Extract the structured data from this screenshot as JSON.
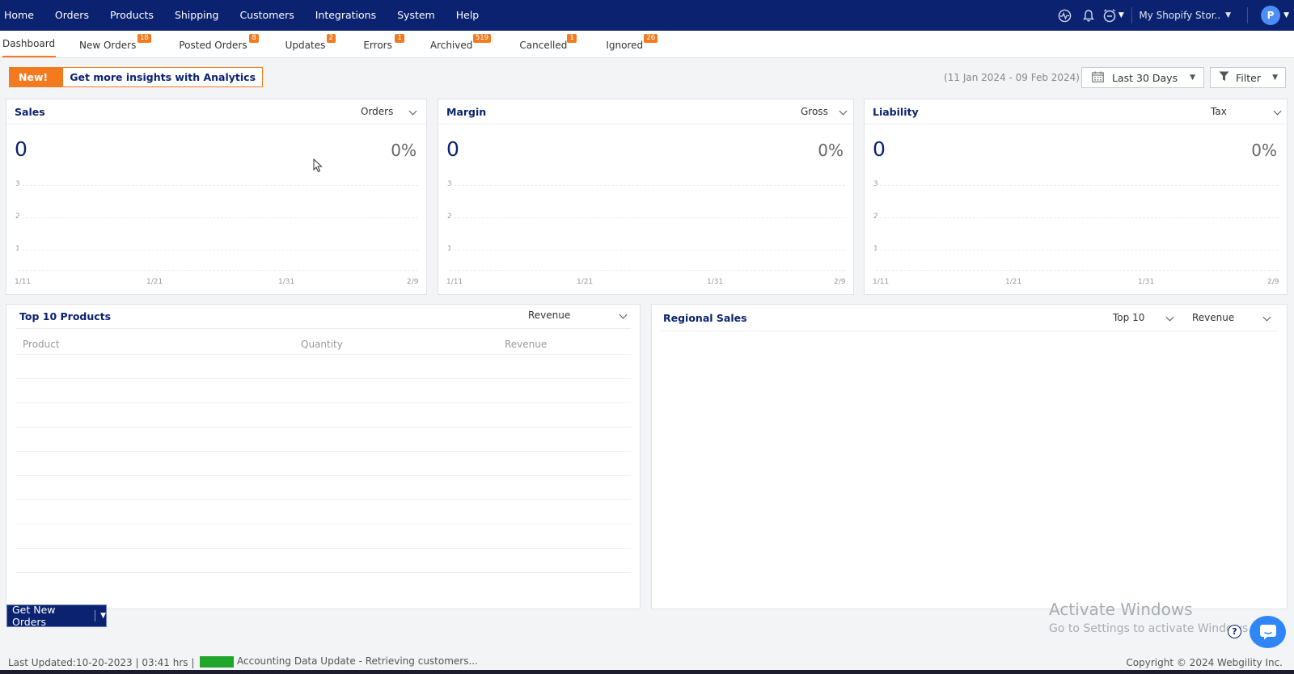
{
  "nav": {
    "menu": [
      "Home",
      "Orders",
      "Products",
      "Shipping",
      "Customers",
      "Integrations",
      "System",
      "Help"
    ],
    "store_name": "My Shopify Stor..",
    "avatar_letter": "P",
    "icons": [
      "activity-icon",
      "bell-icon",
      "alarm-clock-icon"
    ]
  },
  "tabs": [
    {
      "label": "Dashboard",
      "badge": "",
      "active": true
    },
    {
      "label": "New Orders",
      "badge": "18"
    },
    {
      "label": "Posted Orders",
      "badge": "8"
    },
    {
      "label": "Updates",
      "badge": "2"
    },
    {
      "label": "Errors",
      "badge": "1"
    },
    {
      "label": "Archived",
      "badge": "519"
    },
    {
      "label": "Cancelled",
      "badge": "1"
    },
    {
      "label": "Ignored",
      "badge": "26"
    }
  ],
  "promo": {
    "new_label": "New!",
    "message": "Get more insights with Analytics"
  },
  "date_range": "(11 Jan 2024 - 09 Feb 2024)",
  "period_select": "Last 30 Days",
  "filter_label": "Filter",
  "cards": {
    "sales": {
      "title": "Sales",
      "select": "Orders",
      "value": "0",
      "percent": "0%"
    },
    "margin": {
      "title": "Margin",
      "select": "Gross",
      "value": "0",
      "percent": "0%"
    },
    "liability": {
      "title": "Liability",
      "select": "Tax",
      "value": "0",
      "percent": "0%"
    }
  },
  "chart_data": [
    {
      "type": "line",
      "title": "Sales",
      "x": [
        "1/11",
        "1/21",
        "1/31",
        "2/9"
      ],
      "yticks": [
        "3",
        "2",
        "1"
      ],
      "series": []
    },
    {
      "type": "line",
      "title": "Margin",
      "x": [
        "1/11",
        "1/21",
        "1/31",
        "2/9"
      ],
      "yticks": [
        "3",
        "2",
        "1"
      ],
      "series": []
    },
    {
      "type": "line",
      "title": "Liability",
      "x": [
        "1/11",
        "1/21",
        "1/31",
        "2/9"
      ],
      "yticks": [
        "3",
        "2",
        "1"
      ],
      "series": []
    }
  ],
  "top_products": {
    "title": "Top 10 Products",
    "select": "Revenue",
    "columns": [
      "Product",
      "Quantity",
      "Revenue"
    ]
  },
  "regional": {
    "title": "Regional Sales",
    "select_count": "Top 10",
    "select_metric": "Revenue"
  },
  "get_orders_button": "Get New Orders",
  "watermark": {
    "line1": "Activate Windows",
    "line2": "Go to Settings to activate Windows."
  },
  "footer": {
    "last_updated": "Last Updated:10-20-2023 | 03:41 hrs |",
    "status": "Accounting Data Update - Retrieving customers...",
    "copyright": "Copyright © 2024 Webgility Inc."
  },
  "colors": {
    "navy": "#0b2270",
    "orange": "#f47a20",
    "green": "#22a52b",
    "chat_blue": "#2f86f6"
  }
}
